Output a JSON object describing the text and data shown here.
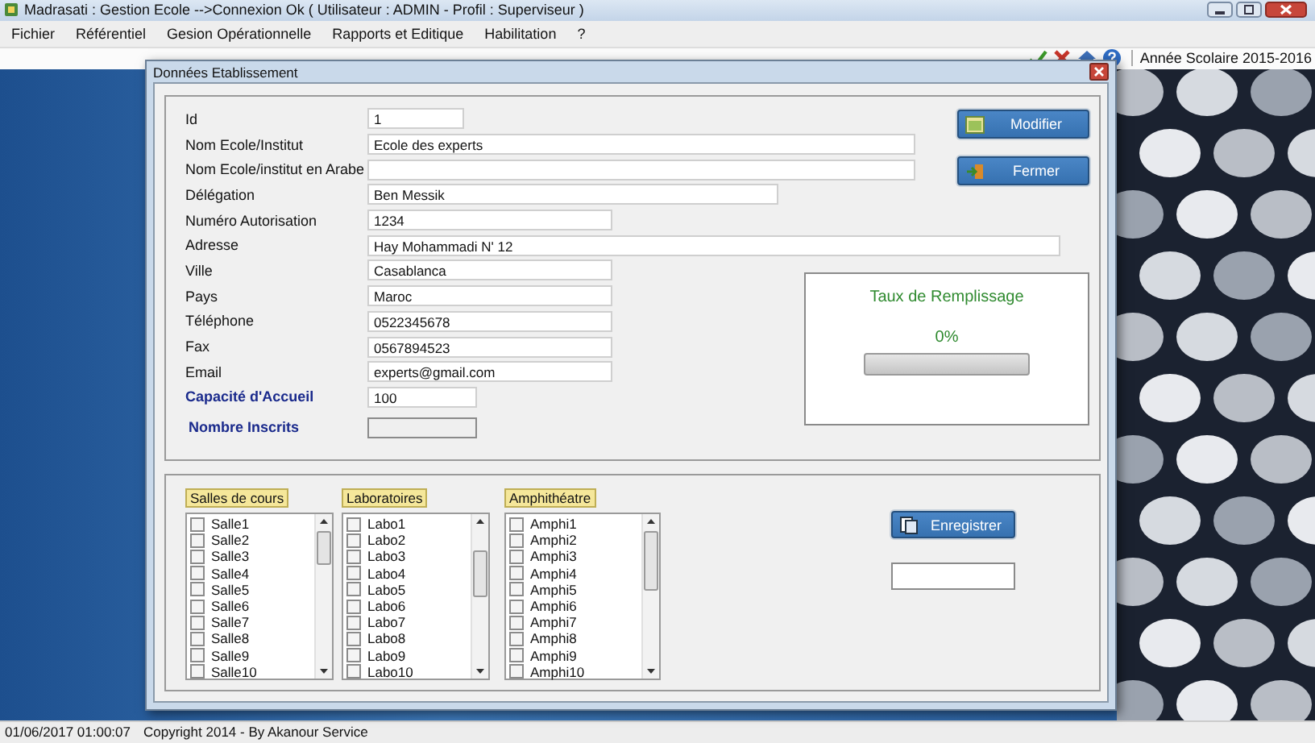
{
  "window": {
    "title": "Madrasati : Gestion Ecole -->Connexion Ok ( Utilisateur : ADMIN - Profil : Superviseur )"
  },
  "menu": [
    "Fichier",
    "Référentiel",
    "Gesion Opérationnelle",
    "Rapports et Editique",
    "Habilitation",
    "?"
  ],
  "toolbar": {
    "school_year": "Année Scolaire 2015-2016"
  },
  "dialog": {
    "title": "Données Etablissement",
    "fields": [
      {
        "label": "Id",
        "value": "1",
        "kind": "normal",
        "disabled": false
      },
      {
        "label": "Nom Ecole/Institut",
        "value": "Ecole des experts",
        "kind": "normal",
        "disabled": false
      },
      {
        "label": "Nom Ecole/institut en Arabe",
        "kind": "normal",
        "disabled": false
      },
      {
        "label": "Délégation",
        "value": "Ben Messik",
        "kind": "normal",
        "disabled": false
      },
      {
        "label": "Numéro Autorisation",
        "value": "1234",
        "kind": "normal",
        "disabled": false
      },
      {
        "label": "Adresse",
        "value": "Hay Mohammadi N' 12",
        "kind": "normal",
        "disabled": false
      },
      {
        "label": "Ville",
        "value": "Casablanca",
        "kind": "normal",
        "disabled": false
      },
      {
        "label": "Pays",
        "value": "Maroc",
        "kind": "normal",
        "disabled": false
      },
      {
        "label": "Téléphone",
        "value": "0522345678",
        "kind": "normal",
        "disabled": false
      },
      {
        "label": "Fax",
        "value": "0567894523",
        "kind": "normal",
        "disabled": false
      },
      {
        "label": "Email",
        "value": "experts@gmail.com",
        "kind": "normal",
        "disabled": false
      },
      {
        "label": "Capacité d'Accueil",
        "value": "100",
        "kind": "emphasis",
        "disabled": false
      },
      {
        "label": "Nombre Inscrits",
        "kind": "emphasis",
        "disabled": true
      }
    ],
    "buttons": [
      "Modifier",
      "Fermer"
    ],
    "fill_rate": {
      "title": "Taux de Remplissage",
      "reading": "0%",
      "level": 0
    },
    "lists": [
      {
        "title": "Salles de cours",
        "items": [
          {
            "label": "Salle1",
            "checked": false
          },
          {
            "label": "Salle2",
            "checked": false
          },
          {
            "label": "Salle3",
            "checked": false
          },
          {
            "label": "Salle4",
            "checked": false
          },
          {
            "label": "Salle5",
            "checked": false
          },
          {
            "label": "Salle6",
            "checked": false
          },
          {
            "label": "Salle7",
            "checked": false
          },
          {
            "label": "Salle8",
            "checked": false
          },
          {
            "label": "Salle9",
            "checked": false
          },
          {
            "label": "Salle10",
            "checked": false
          }
        ]
      },
      {
        "title": "Laboratoires",
        "items": [
          {
            "label": "Labo1",
            "checked": false
          },
          {
            "label": "Labo2",
            "checked": false
          },
          {
            "label": "Labo3",
            "checked": false
          },
          {
            "label": "Labo4",
            "checked": false
          },
          {
            "label": "Labo5",
            "checked": false
          },
          {
            "label": "Labo6",
            "checked": false
          },
          {
            "label": "Labo7",
            "checked": false
          },
          {
            "label": "Labo8",
            "checked": false
          },
          {
            "label": "Labo9",
            "checked": false
          },
          {
            "label": "Labo10",
            "checked": false
          }
        ]
      },
      {
        "title": "Amphithéatre",
        "items": [
          {
            "label": "Amphi1",
            "checked": false
          },
          {
            "label": "Amphi2",
            "checked": false
          },
          {
            "label": "Amphi3",
            "checked": false
          },
          {
            "label": "Amphi4",
            "checked": false
          },
          {
            "label": "Amphi5",
            "checked": false
          },
          {
            "label": "Amphi6",
            "checked": false
          },
          {
            "label": "Amphi7",
            "checked": false
          },
          {
            "label": "Amphi8",
            "checked": false
          },
          {
            "label": "Amphi9",
            "checked": false
          },
          {
            "label": "Amphi10",
            "checked": false
          }
        ]
      }
    ],
    "save_button": "Enregistrer"
  },
  "status_bar": {
    "datetime": "01/06/2017 01:00:07",
    "copyright": "Copyright 2014 - By Akanour Service"
  }
}
